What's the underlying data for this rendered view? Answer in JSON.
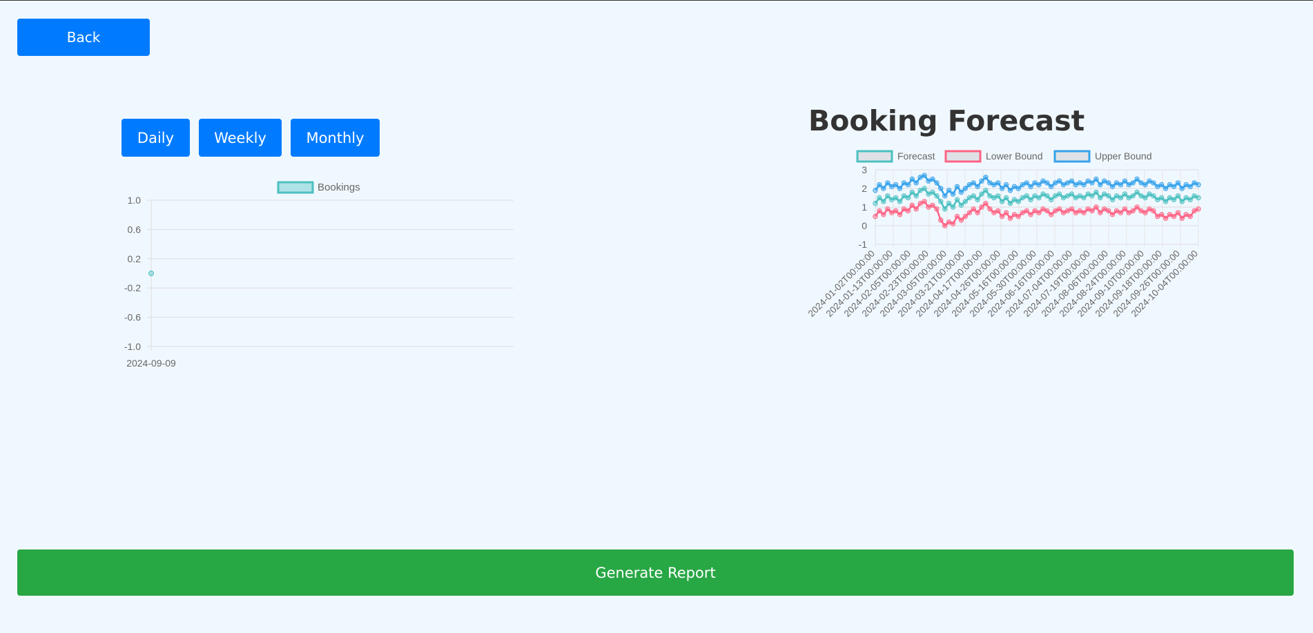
{
  "nav": {
    "back_label": "Back"
  },
  "period_buttons": {
    "daily": "Daily",
    "weekly": "Weekly",
    "monthly": "Monthly"
  },
  "forecast_heading": "Booking Forecast",
  "footer": {
    "report_label": "Generate Report"
  },
  "colors": {
    "primary": "#007bff",
    "success": "#28a745",
    "teal": "#4bc0c0",
    "red": "#ff6384",
    "blue": "#36a2eb"
  },
  "chart_data": [
    {
      "type": "line",
      "legend": [
        "Bookings"
      ],
      "legend_position": "top",
      "categories": [
        "2024-09-09"
      ],
      "series": [
        {
          "name": "Bookings",
          "values": [
            0
          ]
        }
      ],
      "ylim": [
        -1.0,
        1.0
      ],
      "y_ticks": [
        "1.0",
        "0.6",
        "0.2",
        "-0.2",
        "-0.6",
        "-1.0"
      ],
      "grid": true
    },
    {
      "type": "line",
      "legend": [
        "Forecast",
        "Lower Bound",
        "Upper Bound"
      ],
      "legend_position": "top",
      "x_ticks": [
        "2024-01-02T00:00:00",
        "2024-01-13T00:00:00",
        "2024-02-05T00:00:00",
        "2024-02-23T00:00:00",
        "2024-03-05T00:00:00",
        "2024-03-21T00:00:00",
        "2024-04-17T00:00:00",
        "2024-04-26T00:00:00",
        "2024-05-16T00:00:00",
        "2024-05-30T00:00:00",
        "2024-06-16T00:00:00",
        "2024-07-04T00:00:00",
        "2024-07-19T00:00:00",
        "2024-08-06T00:00:00",
        "2024-08-24T00:00:00",
        "2024-09-10T00:00:00",
        "2024-09-18T00:00:00",
        "2024-09-26T00:00:00",
        "2024-10-04T00:00:00"
      ],
      "y_ticks": [
        "3",
        "2",
        "1",
        "0",
        "-1"
      ],
      "ylim": [
        -1,
        3
      ],
      "grid": true,
      "series": [
        {
          "name": "Forecast",
          "values": [
            1.2,
            1.5,
            1.3,
            1.6,
            1.4,
            1.5,
            1.3,
            1.6,
            1.5,
            1.8,
            1.6,
            1.9,
            2.0,
            1.7,
            1.8,
            1.6,
            1.3,
            0.9,
            1.2,
            1.0,
            1.4,
            1.1,
            1.3,
            1.5,
            1.6,
            1.4,
            1.7,
            1.9,
            1.6,
            1.5,
            1.6,
            1.3,
            1.5,
            1.2,
            1.4,
            1.3,
            1.5,
            1.6,
            1.4,
            1.6,
            1.5,
            1.7,
            1.6,
            1.4,
            1.6,
            1.7,
            1.5,
            1.6,
            1.7,
            1.5,
            1.6,
            1.5,
            1.7,
            1.6,
            1.8,
            1.5,
            1.7,
            1.6,
            1.4,
            1.6,
            1.5,
            1.7,
            1.5,
            1.6,
            1.8,
            1.6,
            1.5,
            1.7,
            1.6,
            1.4,
            1.5,
            1.3,
            1.5,
            1.4,
            1.6,
            1.3,
            1.5,
            1.4,
            1.6,
            1.5
          ]
        },
        {
          "name": "Lower Bound",
          "values": [
            0.5,
            0.8,
            0.6,
            0.9,
            0.7,
            0.8,
            0.6,
            0.9,
            0.8,
            1.1,
            0.9,
            1.2,
            1.3,
            1.0,
            1.1,
            0.9,
            0.3,
            0.0,
            0.2,
            0.1,
            0.5,
            0.3,
            0.5,
            0.7,
            0.9,
            0.7,
            1.0,
            1.2,
            0.9,
            0.7,
            0.8,
            0.5,
            0.7,
            0.4,
            0.6,
            0.5,
            0.7,
            0.8,
            0.6,
            0.8,
            0.7,
            0.9,
            0.8,
            0.6,
            0.8,
            0.9,
            0.7,
            0.8,
            0.9,
            0.7,
            0.8,
            0.7,
            0.9,
            0.8,
            1.0,
            0.7,
            0.9,
            0.8,
            0.6,
            0.8,
            0.7,
            0.9,
            0.7,
            0.8,
            1.0,
            0.8,
            0.7,
            0.9,
            0.8,
            0.5,
            0.6,
            0.4,
            0.6,
            0.5,
            0.7,
            0.4,
            0.6,
            0.5,
            0.8,
            0.9
          ]
        },
        {
          "name": "Upper Bound",
          "values": [
            1.9,
            2.2,
            2.0,
            2.3,
            2.1,
            2.2,
            2.0,
            2.3,
            2.2,
            2.5,
            2.3,
            2.6,
            2.7,
            2.4,
            2.5,
            2.3,
            2.0,
            1.6,
            1.9,
            1.7,
            2.1,
            1.8,
            2.0,
            2.2,
            2.3,
            2.1,
            2.4,
            2.6,
            2.3,
            2.2,
            2.3,
            2.0,
            2.2,
            1.9,
            2.1,
            2.0,
            2.2,
            2.3,
            2.1,
            2.3,
            2.2,
            2.4,
            2.3,
            2.1,
            2.3,
            2.4,
            2.2,
            2.3,
            2.4,
            2.2,
            2.3,
            2.2,
            2.4,
            2.3,
            2.5,
            2.2,
            2.4,
            2.3,
            2.1,
            2.3,
            2.2,
            2.4,
            2.2,
            2.3,
            2.5,
            2.3,
            2.2,
            2.4,
            2.3,
            2.1,
            2.2,
            2.0,
            2.2,
            2.1,
            2.3,
            2.0,
            2.2,
            2.1,
            2.3,
            2.2
          ]
        }
      ]
    }
  ]
}
